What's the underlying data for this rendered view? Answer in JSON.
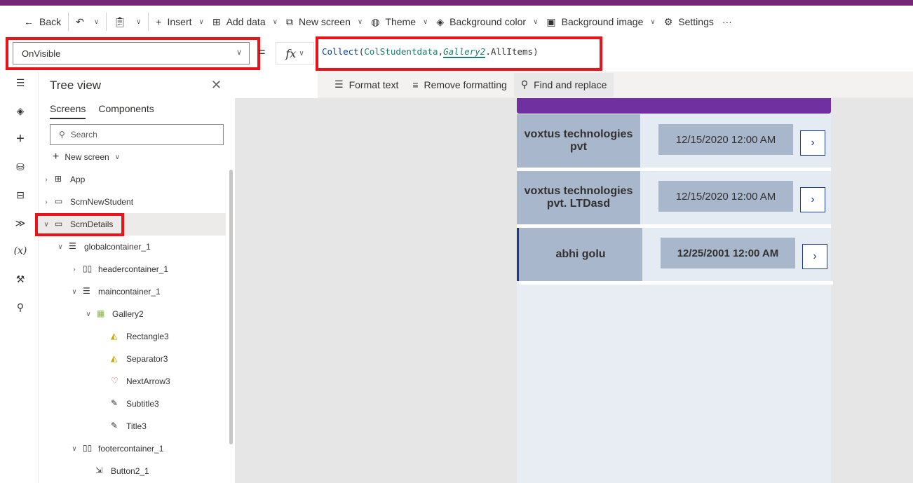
{
  "commandbar": {
    "back": "Back",
    "insert": "Insert",
    "add_data": "Add data",
    "new_screen": "New screen",
    "theme": "Theme",
    "background_color": "Background color",
    "background_image": "Background image",
    "settings": "Settings",
    "more": "···"
  },
  "formula_bar": {
    "property": "OnVisible",
    "equals": "=",
    "fx": "fx",
    "formula_fn": "Collect",
    "formula_collection": "ColStudentdata",
    "formula_control": "Gallery2",
    "formula_rest": ".AllItems",
    "format_text": "Format text",
    "remove_formatting": "Remove formatting",
    "find_replace": "Find and replace"
  },
  "tree": {
    "title": "Tree view",
    "tab_screens": "Screens",
    "tab_components": "Components",
    "search_placeholder": "Search",
    "new_screen": "New screen",
    "items": [
      {
        "label": "App"
      },
      {
        "label": "ScrnNewStudent"
      },
      {
        "label": "ScrnDetails"
      },
      {
        "label": "globalcontainer_1"
      },
      {
        "label": "headercontainer_1"
      },
      {
        "label": "maincontainer_1"
      },
      {
        "label": "Gallery2"
      },
      {
        "label": "Rectangle3"
      },
      {
        "label": "Separator3"
      },
      {
        "label": "NextArrow3"
      },
      {
        "label": "Subtitle3"
      },
      {
        "label": "Title3"
      },
      {
        "label": "footercontainer_1"
      },
      {
        "label": "Button2_1"
      }
    ]
  },
  "gallery": {
    "rows": [
      {
        "title": "voxtus technologies pvt",
        "date": "12/15/2020 12:00 AM"
      },
      {
        "title": "voxtus technologies pvt. LTDasd",
        "date": "12/15/2020 12:00 AM"
      },
      {
        "title": "abhi golu",
        "date": "12/25/2001 12:00 AM"
      }
    ]
  },
  "colors": {
    "accent": "#742774",
    "header": "#7030a0",
    "highlight": "#e8141a"
  }
}
